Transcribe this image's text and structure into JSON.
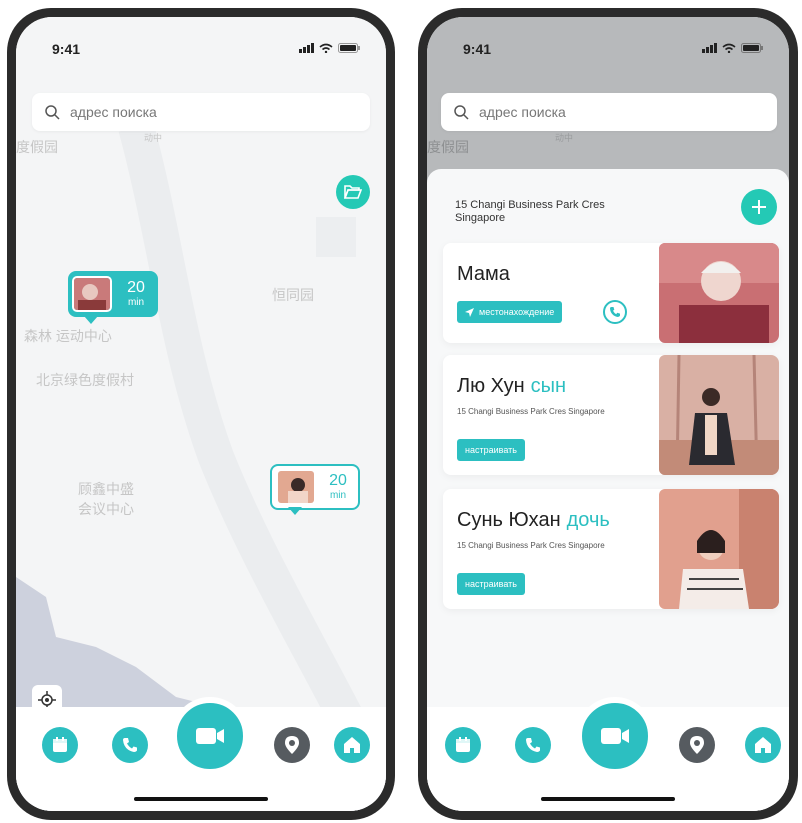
{
  "status": {
    "time": "9:41"
  },
  "search": {
    "placeholder": "адрес поиска"
  },
  "map": {
    "labels": [
      "度假园",
      "恒同园",
      "森林 运动中心",
      "北京绿色度假村",
      "顾鑫中盛",
      "会议中心",
      "动中"
    ],
    "pins": [
      {
        "value": "20",
        "unit": "min"
      },
      {
        "value": "20",
        "unit": "min"
      }
    ]
  },
  "sheet": {
    "address": "15 Changi Business Park Cres Singapore",
    "contacts": [
      {
        "name": "Мама",
        "role": "",
        "action": "местонахождение"
      },
      {
        "name": "Лю Хун",
        "role": "сын",
        "address": "15 Changi Business Park Cres Singapore",
        "action": "настраивать"
      },
      {
        "name": "Сунь Юхан",
        "role": "дочь",
        "address": "15 Changi Business Park Cres Singapore",
        "action": "настраивать"
      }
    ]
  },
  "tabbar": {
    "icons": [
      "calendar-icon",
      "phone-icon",
      "video-camera-icon",
      "location-pin-icon",
      "home-icon"
    ]
  },
  "colors": {
    "accent": "#2cbfc1",
    "accent_green": "#24c9b5",
    "dark_tab": "#565b60"
  }
}
